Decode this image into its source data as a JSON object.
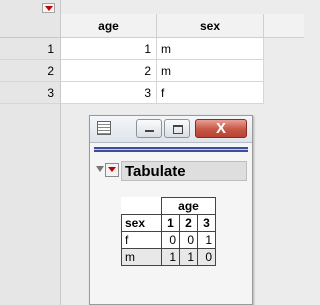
{
  "grid": {
    "columns": [
      {
        "name": "age"
      },
      {
        "name": "sex"
      }
    ],
    "rows": [
      {
        "row_number": "1",
        "age": "1",
        "sex": "m"
      },
      {
        "row_number": "2",
        "age": "2",
        "sex": "m"
      },
      {
        "row_number": "3",
        "age": "3",
        "sex": "f"
      }
    ]
  },
  "report_window": {
    "icons": {
      "app": "report-window-icon",
      "minimize": "minimize-icon",
      "maximize": "maximize-icon",
      "close": "close-icon"
    },
    "close_glyph": "X",
    "outline_title": "Tabulate",
    "table": {
      "column_header": "age",
      "row_header": "sex",
      "age_levels": [
        "1",
        "2",
        "3"
      ],
      "rows": [
        {
          "label": "f",
          "counts": [
            "0",
            "0",
            "1"
          ]
        },
        {
          "label": "m",
          "counts": [
            "1",
            "1",
            "0"
          ]
        }
      ]
    }
  },
  "colors": {
    "accent_bar": "#3f4e9c",
    "close_button": "#c65645",
    "menu_triangle": "#c00000"
  }
}
